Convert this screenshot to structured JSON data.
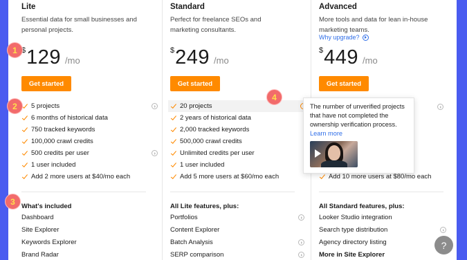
{
  "plans": [
    {
      "name": "Lite",
      "description": "Essential data for small businesses and personal projects.",
      "currency": "$",
      "price": "129",
      "period": "/mo",
      "cta": "Get started",
      "features": [
        "5 projects",
        "6 months of historical data",
        "750 tracked keywords",
        "100,000 crawl credits",
        "500 credits per user",
        "1 user included",
        "Add 2 more users at $40/mo each"
      ],
      "included_title": "What's included",
      "included": [
        "Dashboard",
        "Site Explorer",
        "Keywords Explorer",
        "Brand Radar"
      ]
    },
    {
      "name": "Standard",
      "description": "Perfect for freelance SEOs and marketing consultants.",
      "currency": "$",
      "price": "249",
      "period": "/mo",
      "cta": "Get started",
      "features": [
        "20 projects",
        "2 years of historical data",
        "2,000 tracked keywords",
        "500,000 crawl credits",
        "Unlimited credits per user",
        "1 user included",
        "Add 5 more users at $60/mo each"
      ],
      "included_title": "All Lite features, plus:",
      "included": [
        "Portfolios",
        "Content Explorer",
        "Batch Analysis",
        "SERP comparison"
      ]
    },
    {
      "name": "Advanced",
      "description": "More tools and data for lean in-house marketing teams.",
      "upgrade_link": "Why upgrade?",
      "currency": "$",
      "price": "449",
      "period": "/mo",
      "cta": "Get started",
      "features_visible_last": "Add 10 more users at $80/mo each",
      "included_title": "All Standard features, plus:",
      "included": [
        "Looker Studio integration",
        "Search type distribution",
        "Agency directory listing",
        "More in Site Explorer"
      ]
    }
  ],
  "tooltip": {
    "text": "The number of unverified projects that have not completed the ownership verification process.",
    "link": "Learn more",
    "video_icon": "play-icon"
  },
  "badges": [
    "1",
    "2",
    "3",
    "4"
  ],
  "help_button": "?",
  "colors": {
    "accent": "#ff8a00",
    "background": "#4a5cf0",
    "link": "#2f6ee8",
    "badge": "#f26b6b"
  }
}
